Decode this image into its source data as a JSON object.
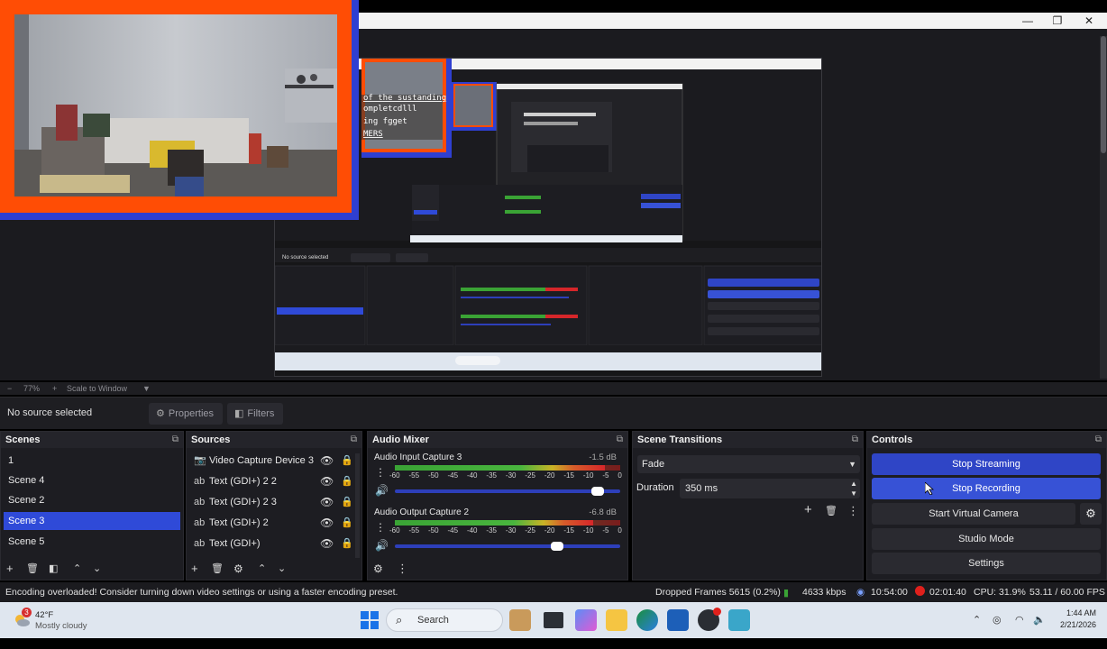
{
  "window": {
    "controls": {
      "minimize": "—",
      "maximize": "❐",
      "close": "✕"
    }
  },
  "zoom": {
    "level": "77%",
    "scale_label": "Scale to Window"
  },
  "properties_bar": {
    "no_source": "No source selected",
    "properties": "Properties",
    "filters": "Filters"
  },
  "scenes": {
    "title": "Scenes",
    "items": [
      {
        "label": "1"
      },
      {
        "label": "Scene 4"
      },
      {
        "label": "Scene 2"
      },
      {
        "label": "Scene 3",
        "selected": true
      },
      {
        "label": "Scene 5"
      }
    ]
  },
  "sources": {
    "title": "Sources",
    "items": [
      {
        "label": "Video Capture Device 3",
        "icon": "camera-icon"
      },
      {
        "label": "Text (GDI+) 2 2",
        "icon": "text-icon"
      },
      {
        "label": "Text (GDI+) 2 3",
        "icon": "text-icon"
      },
      {
        "label": "Text (GDI+) 2",
        "icon": "text-icon"
      },
      {
        "label": "Text (GDI+)",
        "icon": "text-icon"
      }
    ]
  },
  "audio_mixer": {
    "title": "Audio Mixer",
    "ticks": [
      "-60",
      "-55",
      "-50",
      "-45",
      "-40",
      "-35",
      "-30",
      "-25",
      "-20",
      "-15",
      "-10",
      "-5",
      "0"
    ],
    "channels": [
      {
        "name": "Audio Input Capture 3",
        "db": "-1.5 dB",
        "level": 0.93,
        "volume": 0.9
      },
      {
        "name": "Audio Output Capture 2",
        "db": "-6.8 dB",
        "level": 0.88,
        "volume": 0.72
      }
    ]
  },
  "scene_transitions": {
    "title": "Scene Transitions",
    "transition": "Fade",
    "duration_label": "Duration",
    "duration_value": "350 ms"
  },
  "controls": {
    "title": "Controls",
    "stop_streaming": "Stop Streaming",
    "stop_recording": "Stop Recording",
    "virtual_camera": "Start Virtual Camera",
    "studio_mode": "Studio Mode",
    "settings": "Settings"
  },
  "status": {
    "message": "Encoding overloaded! Consider turning down video settings or using a faster encoding preset.",
    "dropped_frames": "Dropped Frames 5615 (0.2%)",
    "bitrate": "4633 kbps",
    "stream_time": "10:54:00",
    "rec_time": "02:01:40",
    "cpu": "CPU: 31.9%",
    "fps": "53.11 / 60.00 FPS"
  },
  "taskbar": {
    "weather_temp": "42°F",
    "weather_desc": "Mostly cloudy",
    "weather_badge": "3",
    "search_placeholder": "Search",
    "time": "1:44 AM",
    "date": "2/21/2026"
  },
  "colors": {
    "accent_blue": "#2f45c6",
    "cam_border_orange": "#ff4d05",
    "cam_border_blue": "#2f3fd1",
    "rec_red": "#e0201c"
  }
}
